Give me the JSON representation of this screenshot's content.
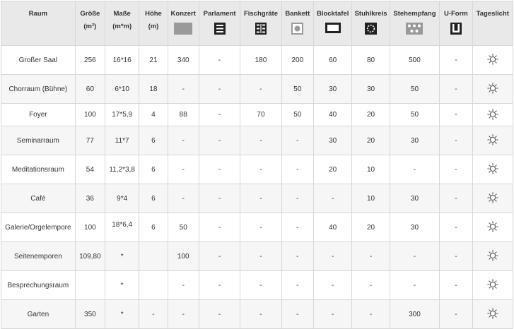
{
  "headers": [
    {
      "line1": "Raum",
      "line2": "",
      "icon": ""
    },
    {
      "line1": "Größe",
      "line2": "(m²)",
      "icon": ""
    },
    {
      "line1": "Maße",
      "line2": "(m*m)",
      "icon": ""
    },
    {
      "line1": "Höhe",
      "line2": "(m)",
      "icon": ""
    },
    {
      "line1": "Konzert",
      "line2": "",
      "icon": "konzert-icon"
    },
    {
      "line1": "Parlament",
      "line2": "",
      "icon": "parlament-icon"
    },
    {
      "line1": "Fischgräte",
      "line2": "",
      "icon": "fischgraete-icon"
    },
    {
      "line1": "Bankett",
      "line2": "",
      "icon": "bankett-icon"
    },
    {
      "line1": "Blocktafel",
      "line2": "",
      "icon": "blocktafel-icon"
    },
    {
      "line1": "Stuhlkreis",
      "line2": "",
      "icon": "stuhlkreis-icon"
    },
    {
      "line1": "Stehempfang",
      "line2": "",
      "icon": "stehempfang-icon"
    },
    {
      "line1": "U-Form",
      "line2": "",
      "icon": "u-form-icon"
    },
    {
      "line1": "Tageslicht",
      "line2": "",
      "icon": ""
    }
  ],
  "rows": [
    {
      "cells": [
        "Großer Saal",
        "256",
        "16*16",
        "21",
        "340",
        "-",
        "180",
        "200",
        "60",
        "80",
        "500",
        "-"
      ],
      "daylight_icon": "sun-icon"
    },
    {
      "cells": [
        "Chorraum (Bühne)",
        "60",
        "6*10",
        "18",
        "-",
        "-",
        "-",
        "50",
        "30",
        "30",
        "50",
        "-"
      ],
      "daylight_icon": "sun-icon"
    },
    {
      "cells": [
        "Foyer",
        "100",
        "17*5,9",
        "4",
        "88",
        "-",
        "70",
        "50",
        "40",
        "20",
        "50",
        "-"
      ],
      "daylight_icon": "sun-icon"
    },
    {
      "cells": [
        "Seminarraum",
        "77",
        "11*7",
        "6",
        "-",
        "-",
        "-",
        "-",
        "30",
        "20",
        "30",
        "-"
      ],
      "daylight_icon": "sun-icon"
    },
    {
      "cells": [
        "Meditationsraum",
        "54",
        "11,2*3,8",
        "6",
        "-",
        "-",
        "-",
        "-",
        "20",
        "10",
        "-",
        "-"
      ],
      "daylight_icon": "sun-icon"
    },
    {
      "cells": [
        "Café",
        "36",
        "9*4",
        "6",
        "-",
        "-",
        "-",
        "-",
        "-",
        "10",
        "30",
        "-"
      ],
      "daylight_icon": "sun-icon"
    },
    {
      "cells": [
        "Galerie/Orgelempore",
        "100",
        "18*6,4",
        "6",
        "50",
        "-",
        "-",
        "-",
        "40",
        "20",
        "30",
        "-"
      ],
      "daylight_icon": "sun-icon"
    },
    {
      "cells": [
        "Seitenemporen",
        "109,80",
        "*",
        "",
        "100",
        "-",
        "-",
        "-",
        "-",
        "-",
        "-",
        "-"
      ],
      "daylight_icon": "sun-icon"
    },
    {
      "cells": [
        "Besprechungsraum",
        "",
        "*",
        "",
        "-",
        "-",
        "-",
        "-",
        "-",
        "-",
        "-",
        "-"
      ],
      "daylight_icon": "sun-icon"
    },
    {
      "cells": [
        "Garten",
        "350",
        "*",
        "-",
        "-",
        "-",
        "-",
        "-",
        "-",
        "-",
        "300",
        "-"
      ],
      "daylight_icon": "sun-icon"
    }
  ],
  "colors": {
    "header_bg": "#e9e9e9",
    "row_alt_bg": "#f6f6f6",
    "border": "#d7d7d7",
    "icon_dark": "#222222",
    "icon_grey": "#9a9a9a",
    "sun": "#555555"
  }
}
